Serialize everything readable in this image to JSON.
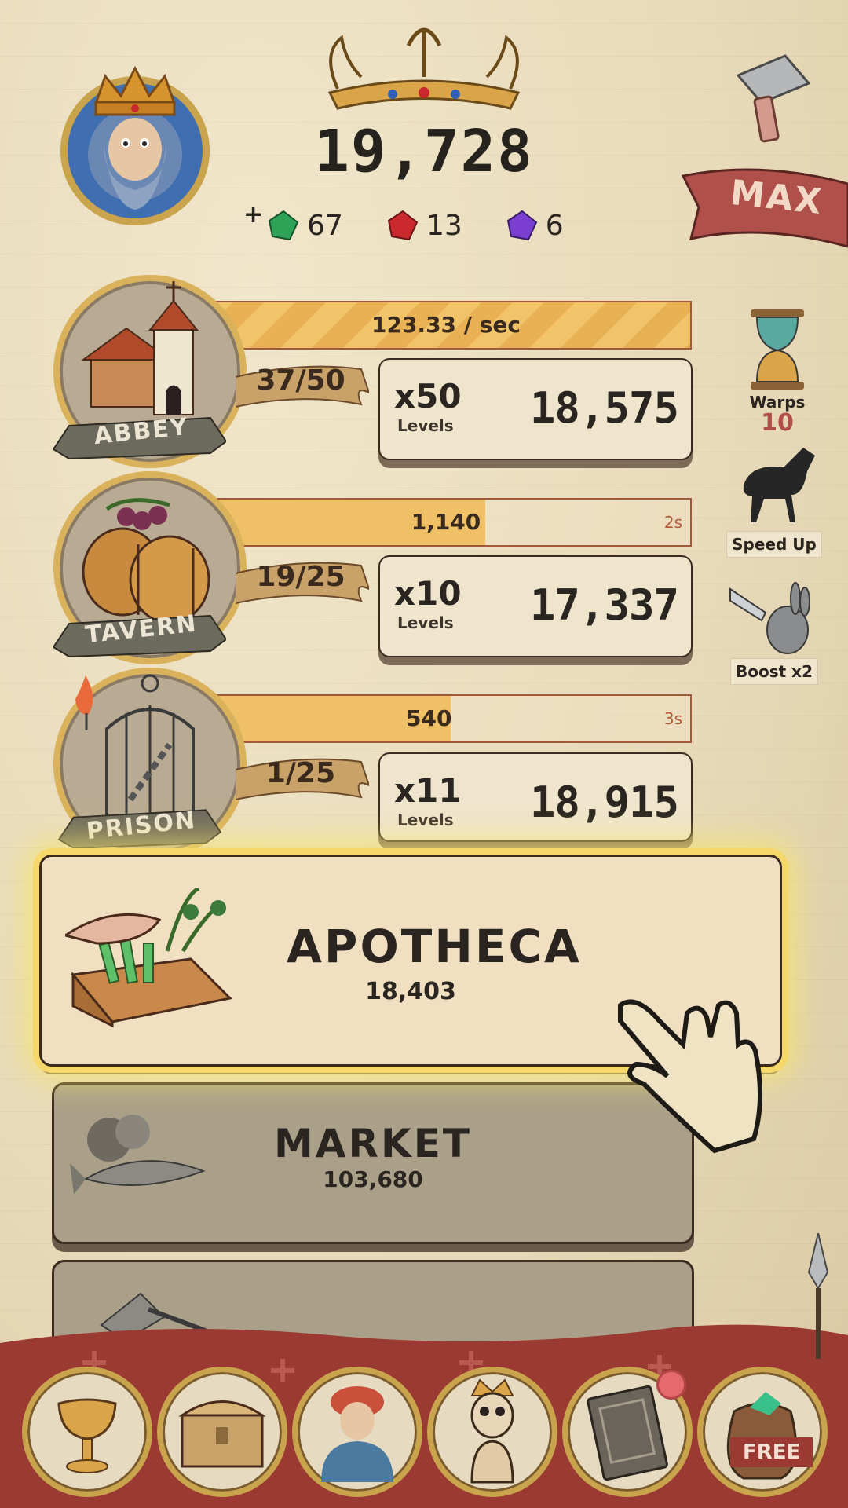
{
  "header": {
    "gold": "19,728",
    "gems": [
      {
        "name": "green-gem",
        "count": "67",
        "color": "#2ea357"
      },
      {
        "name": "red-gem",
        "count": "13",
        "color": "#c9282d"
      },
      {
        "name": "purple-gem",
        "count": "6",
        "color": "#7a3fd0"
      }
    ],
    "plus_symbol": "+",
    "max_label": "MAX"
  },
  "side": {
    "warps_label": "Warps",
    "warps_count": "10",
    "speed_label": "Speed Up",
    "boost_label": "Boost x2"
  },
  "buildings": [
    {
      "name": "ABBEY",
      "rate": "123.33  / sec",
      "time": "",
      "progress": "37/50",
      "fill": 1.0,
      "mult": "x50",
      "levels_label": "Levels",
      "cost": "18,575"
    },
    {
      "name": "TAVERN",
      "rate": "1,140",
      "time": "2s",
      "progress": "19/25",
      "fill": 0.58,
      "mult": "x10",
      "levels_label": "Levels",
      "cost": "17,337"
    },
    {
      "name": "PRISON",
      "rate": "540",
      "time": "3s",
      "progress": "1/25",
      "fill": 0.51,
      "mult": "x11",
      "levels_label": "Levels",
      "cost": "18,915"
    }
  ],
  "unlock_cards": [
    {
      "name": "APOTHECA",
      "cost": "18,403"
    },
    {
      "name": "MARKET",
      "cost": "103,680"
    }
  ],
  "bottom_nav": {
    "free_label": "FREE",
    "items": [
      "chalice-icon",
      "chest-icon",
      "merchant-icon",
      "skeleton-king-icon",
      "book-icon",
      "sack-icon"
    ]
  },
  "colors": {
    "accent_gold": "#f0c066",
    "banner_red": "#9a3a32",
    "highlight": "#f5d76a"
  }
}
